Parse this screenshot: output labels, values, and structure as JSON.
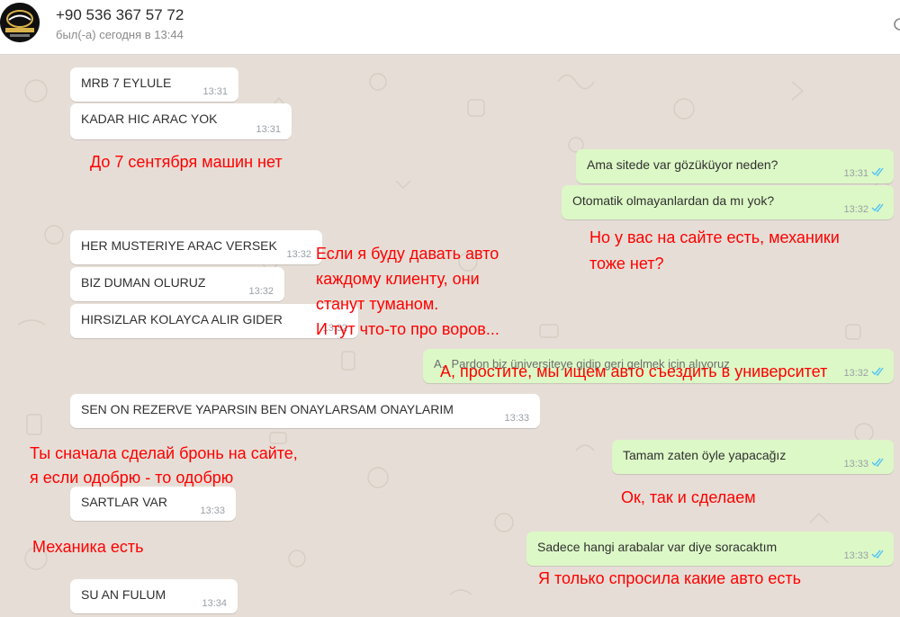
{
  "header": {
    "contact_name": "+90 536 367 57 72",
    "status": "был(-а) сегодня в 13:44",
    "avatar_icon": "ottoman-car-logo-icon"
  },
  "messages": [
    {
      "dir": "in",
      "text": "MRB 7 EYLULE",
      "time": "13:31"
    },
    {
      "dir": "in",
      "text": "KADAR HIC ARAC YOK",
      "time": "13:31"
    },
    {
      "dir": "out",
      "text": "Ama sitede var gözüküyor neden?",
      "time": "13:31",
      "status": "read"
    },
    {
      "dir": "out",
      "text": "Otomatik olmayanlardan da mı yok?",
      "time": "13:32",
      "status": "read"
    },
    {
      "dir": "in",
      "text": "HER MUSTERIYE ARAC VERSEK",
      "time": "13:32"
    },
    {
      "dir": "in",
      "text": "BIZ DUMAN OLURUZ",
      "time": "13:32"
    },
    {
      "dir": "in",
      "text": "HIRSIZLAR KOLAYCA ALIR GIDER",
      "time": "13:32"
    },
    {
      "dir": "out",
      "text": "A.. Pardon biz üniversiteye gidip geri gelmek için alıyoruz",
      "time": "13:32",
      "status": "read"
    },
    {
      "dir": "in",
      "text": "SEN ON REZERVE YAPARSIN BEN ONAYLARSAM ONAYLARIM",
      "time": "13:33"
    },
    {
      "dir": "out",
      "text": "Tamam zaten öyle yapacağız",
      "time": "13:33",
      "status": "read"
    },
    {
      "dir": "in",
      "text": "SARTLAR VAR",
      "time": "13:33"
    },
    {
      "dir": "out",
      "text": "Sadece hangi arabalar var diye soracaktım",
      "time": "13:33",
      "status": "read"
    },
    {
      "dir": "in",
      "text": "SU AN FULUM",
      "time": "13:34"
    }
  ],
  "annotations": [
    "До 7 сентября машин нет",
    "Но у вас на сайте есть, механики",
    "тоже нет?",
    "Если я буду давать авто",
    "каждому клиенту, они",
    "станут туманом.",
    "И тут что-то про воров...",
    "А, простите, мы ищем авто съездить в университет",
    "Ты сначала сделай бронь на сайте,",
    "я если одобрю - то одобрю",
    "Ок, так и сделаем",
    "Механика есть",
    "Я только спросила какие авто есть"
  ],
  "colors": {
    "chat_background": "#e5ded6",
    "incoming_bubble": "#ffffff",
    "outgoing_bubble": "#dcf8c6",
    "read_ticks": "#4fc3f7",
    "annotation_text": "#ff0000"
  }
}
